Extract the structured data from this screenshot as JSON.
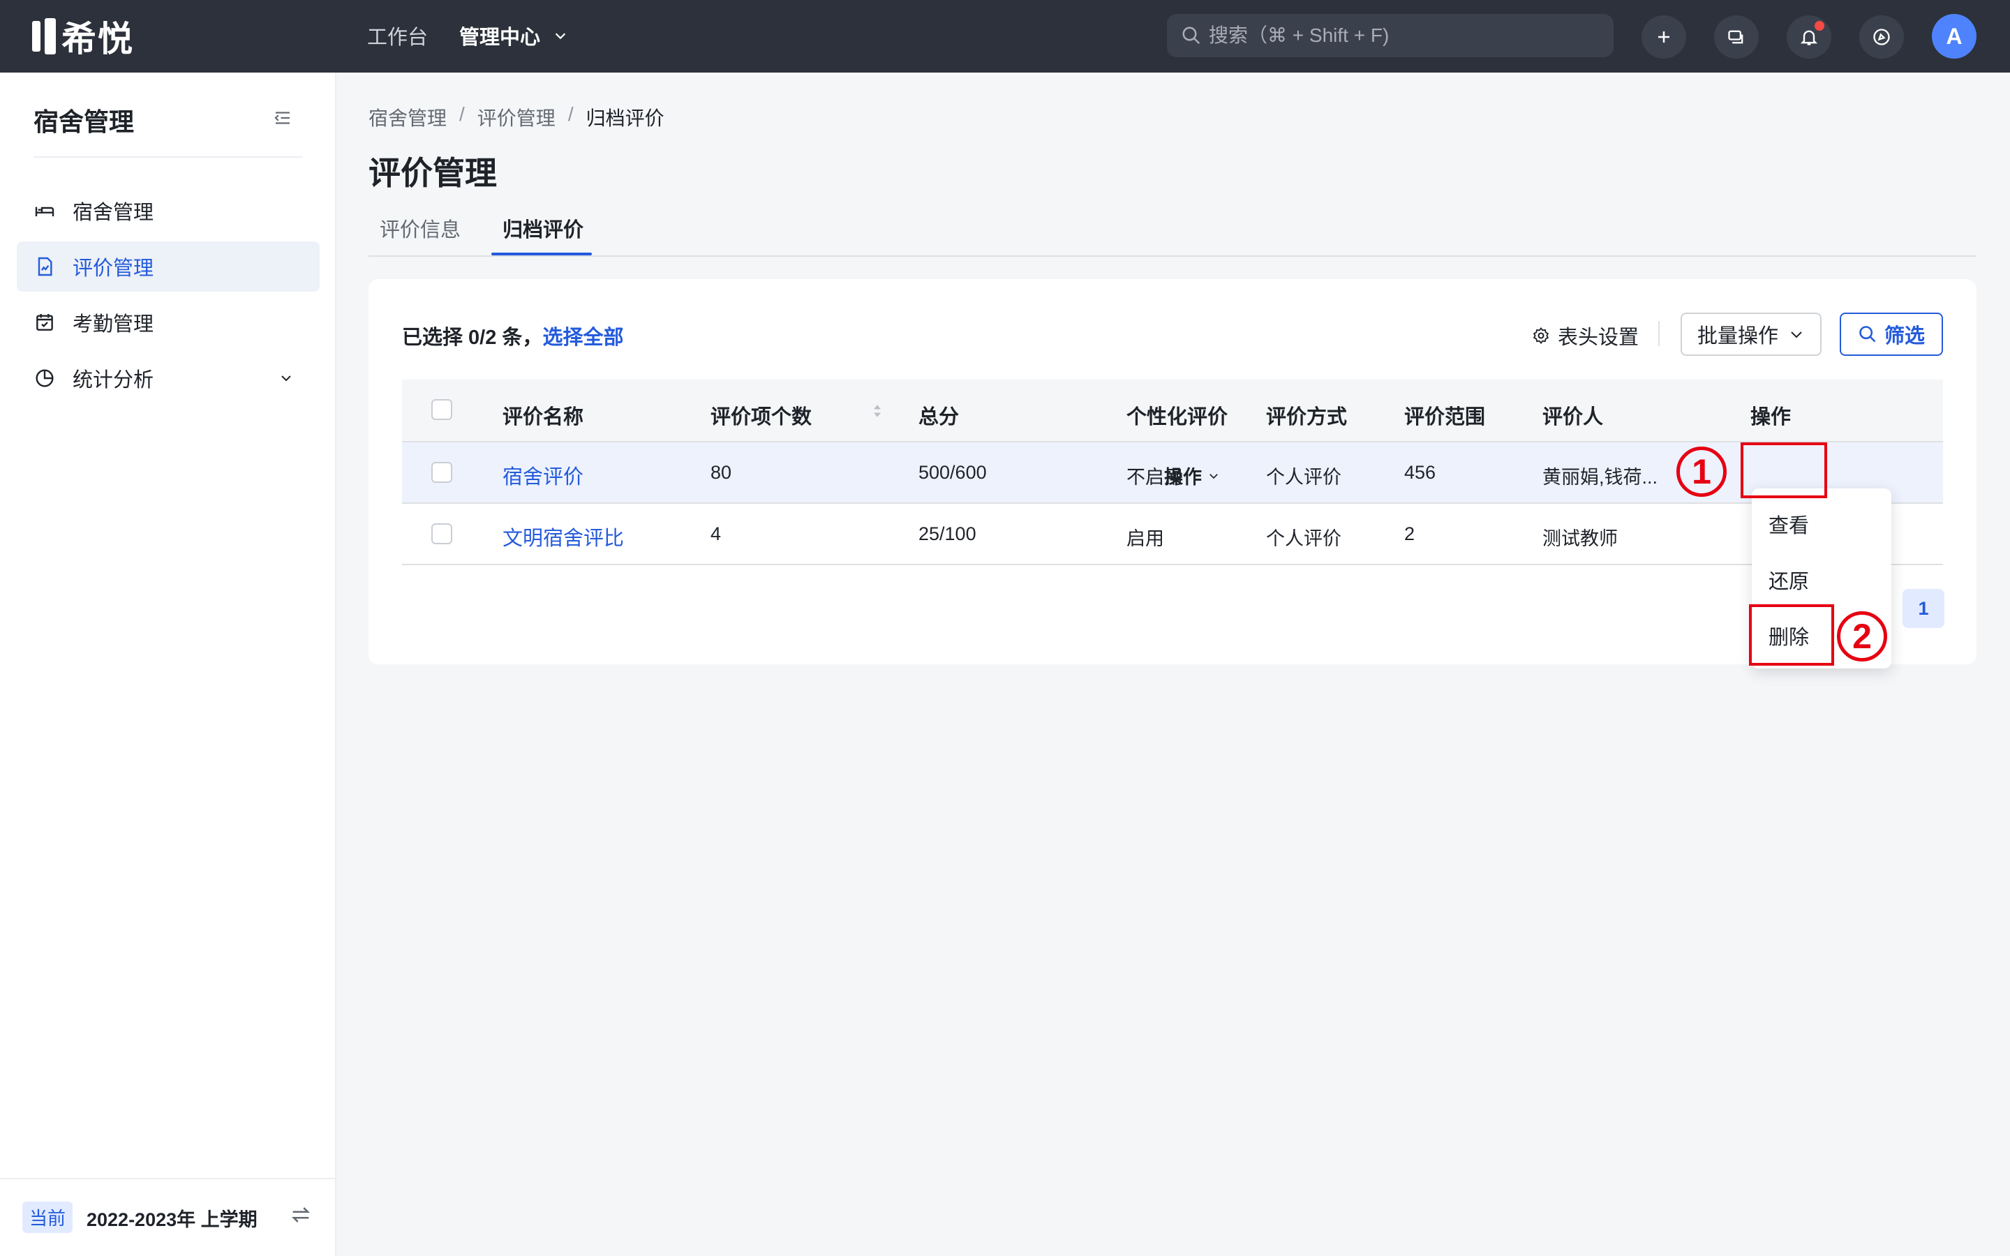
{
  "app": {
    "logo_text": "希悦"
  },
  "topnav": {
    "workbench": "工作台",
    "admin_center": "管理中心"
  },
  "search": {
    "placeholder": "搜索（⌘ + Shift + F)"
  },
  "user": {
    "avatar_letter": "A"
  },
  "sidebar": {
    "title": "宿舍管理",
    "items": [
      {
        "label": "宿舍管理",
        "icon": "bed-icon",
        "active": false
      },
      {
        "label": "评价管理",
        "icon": "evaluation-doc-icon",
        "active": true
      },
      {
        "label": "考勤管理",
        "icon": "calendar-check-icon",
        "active": false
      },
      {
        "label": "统计分析",
        "icon": "pie-chart-icon",
        "active": false,
        "expandable": true
      }
    ],
    "term_badge": "当前",
    "term_text": "2022-2023年 上学期"
  },
  "breadcrumb": [
    "宿舍管理",
    "评价管理",
    "归档评价"
  ],
  "page": {
    "title": "评价管理"
  },
  "tabs": [
    {
      "label": "评价信息",
      "active": false
    },
    {
      "label": "归档评价",
      "active": true
    }
  ],
  "toolbar": {
    "selection_text": "已选择 0/2 条，",
    "select_all": "选择全部",
    "column_settings": "表头设置",
    "batch_ops": "批量操作",
    "filter": "筛选"
  },
  "table": {
    "columns": [
      "评价名称",
      "评价项个数",
      "总分",
      "个性化评价",
      "评价方式",
      "评价范围",
      "评价人",
      "操作"
    ],
    "rows": [
      {
        "name": "宿舍评价",
        "items": "80",
        "total": "500/600",
        "personalized": "不启用",
        "method": "个人评价",
        "scope": "456",
        "evaluator": "黄丽娟,钱荷...",
        "action": "操作"
      },
      {
        "name": "文明宿舍评比",
        "items": "4",
        "total": "25/100",
        "personalized": "启用",
        "method": "个人评价",
        "scope": "2",
        "evaluator": "测试教师",
        "action": ""
      }
    ]
  },
  "pagination": {
    "current": "1"
  },
  "action_menu": {
    "items": [
      "查看",
      "还原",
      "删除"
    ]
  },
  "annotations": {
    "step1": "1",
    "step2": "2"
  },
  "colors": {
    "primary": "#245bdb",
    "topbar": "#2c313b",
    "annotation": "#e60012"
  }
}
